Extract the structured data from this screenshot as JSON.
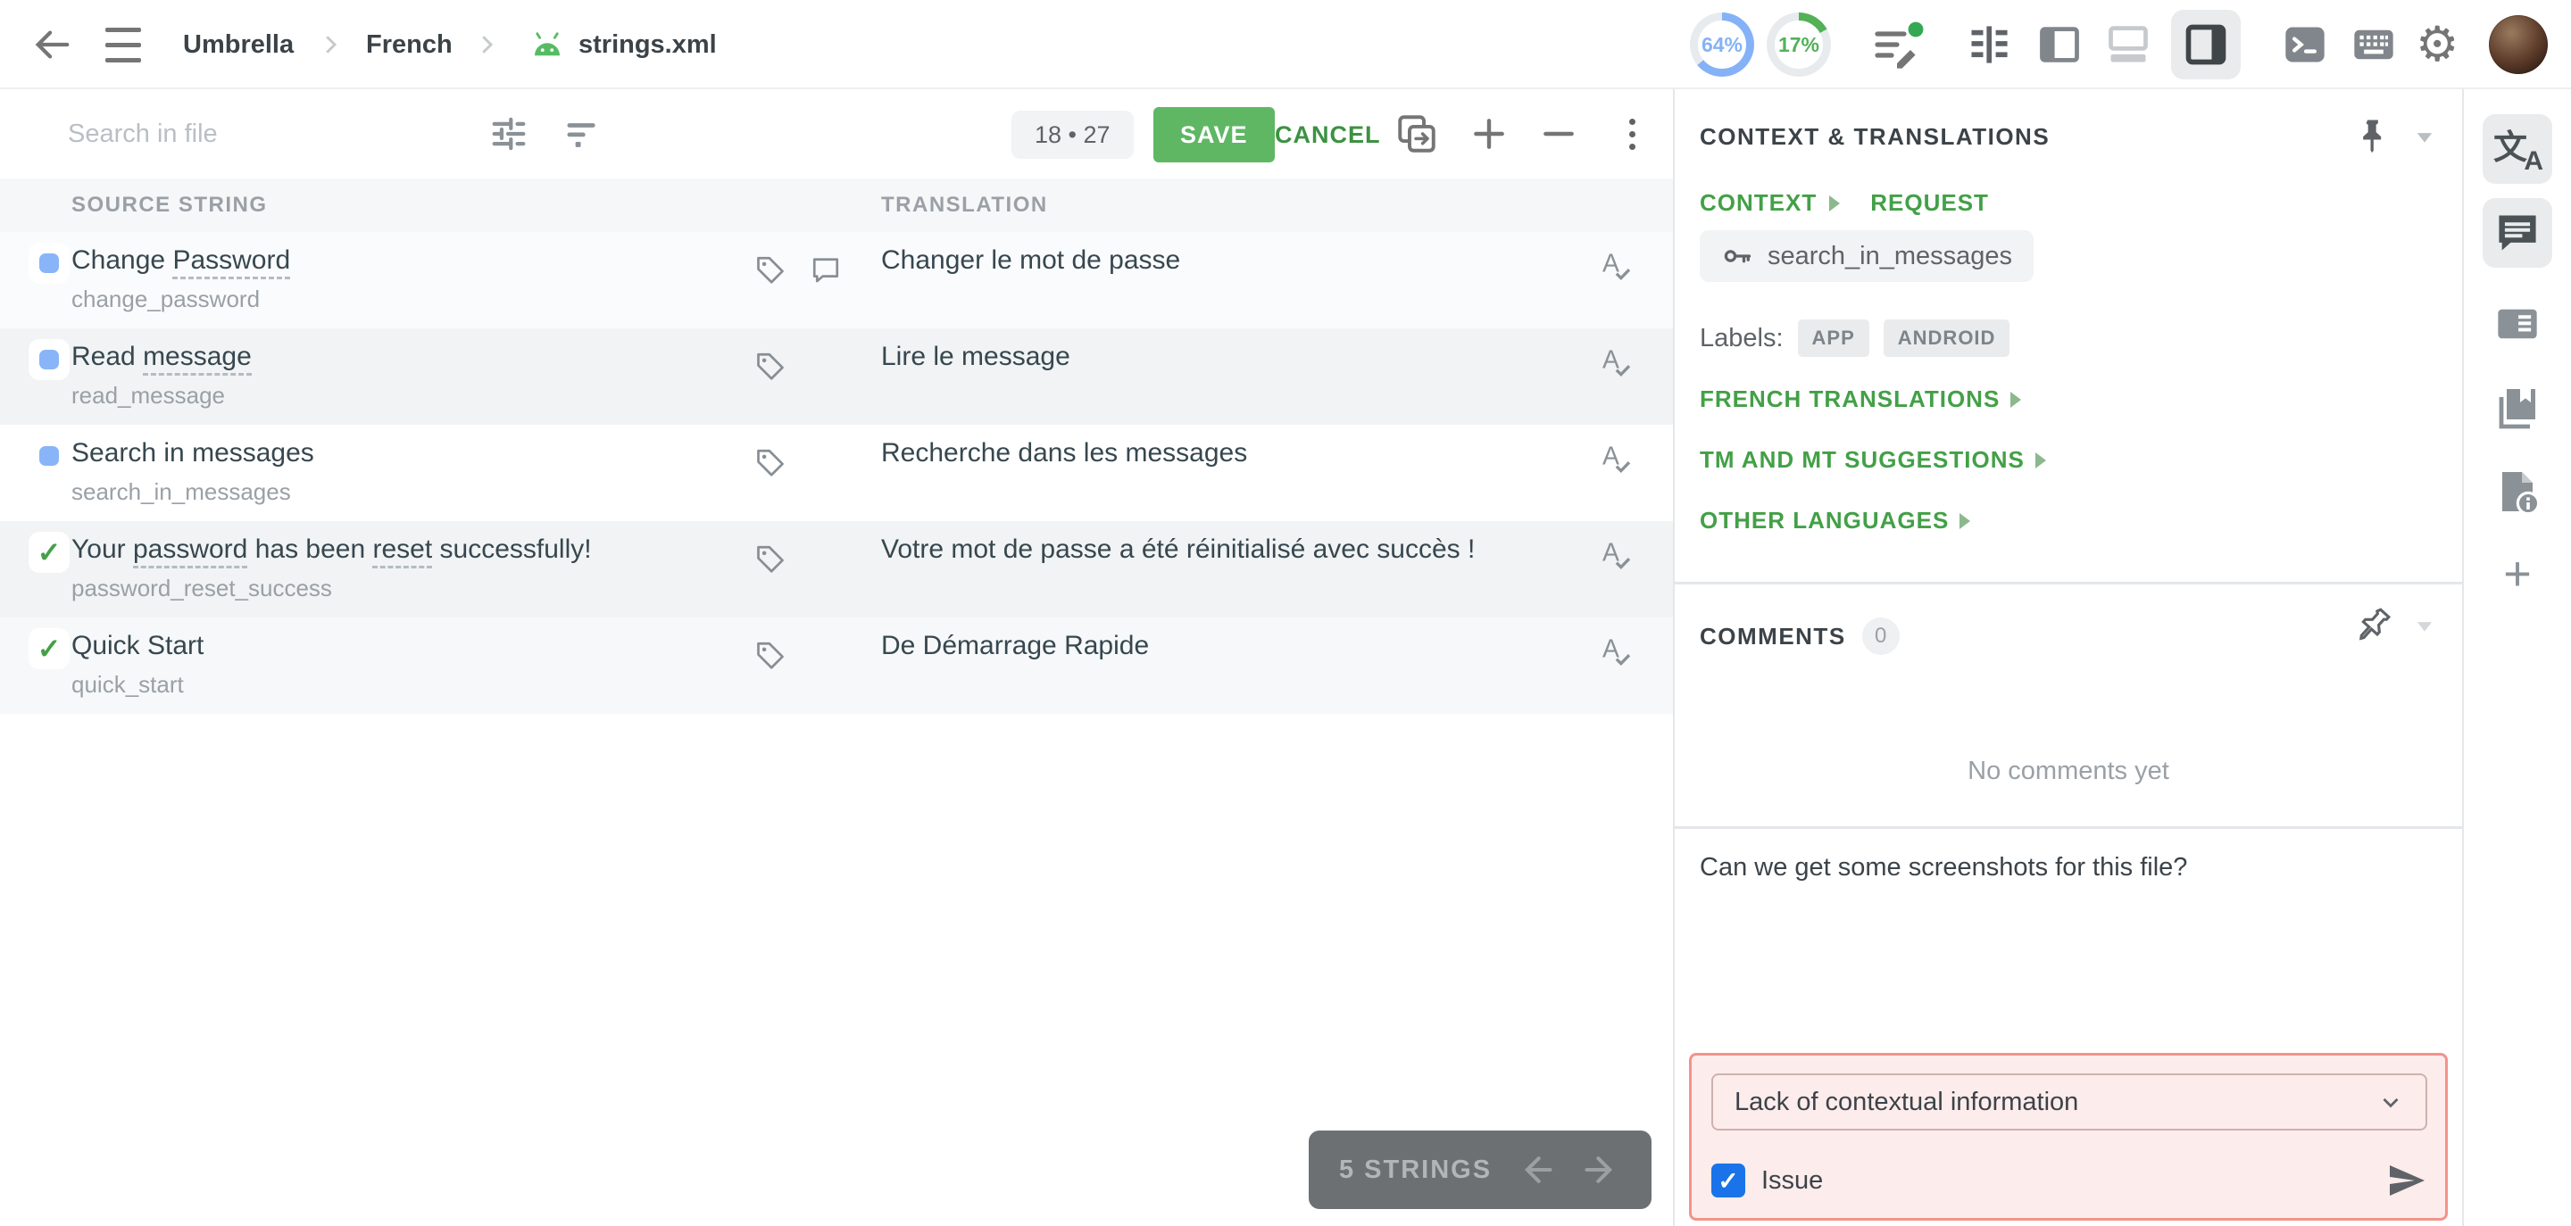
{
  "topbar": {
    "breadcrumb_project": "Umbrella",
    "breadcrumb_language": "French",
    "breadcrumb_file": "strings.xml",
    "progress_translated": "64%",
    "progress_approved": "17%"
  },
  "toolbar": {
    "search_placeholder": "Search in file",
    "counter": "18 • 27",
    "save_label": "SAVE",
    "cancel_label": "CANCEL"
  },
  "table": {
    "source_header": "SOURCE STRING",
    "translation_header": "TRANSLATION"
  },
  "strings": [
    {
      "status": "untranslated",
      "source": [
        {
          "t": "Change ",
          "u": false
        },
        {
          "t": "Password",
          "u": true
        }
      ],
      "key": "change_password",
      "icons": [
        "tag",
        "comment"
      ],
      "translation": "Changer le mot de passe"
    },
    {
      "status": "untranslated",
      "source": [
        {
          "t": "Read ",
          "u": false
        },
        {
          "t": "message",
          "u": true
        }
      ],
      "key": "read_message",
      "icons": [
        "tag"
      ],
      "translation": "Lire le message"
    },
    {
      "status": "untranslated",
      "source": [
        {
          "t": "Search in messages",
          "u": false
        }
      ],
      "key": "search_in_messages",
      "icons": [
        "tag"
      ],
      "translation": "Recherche dans les messages"
    },
    {
      "status": "approved",
      "source": [
        {
          "t": "Your ",
          "u": false
        },
        {
          "t": "password",
          "u": true
        },
        {
          "t": " has been ",
          "u": false
        },
        {
          "t": "reset",
          "u": true
        },
        {
          "t": " successfully!",
          "u": false
        }
      ],
      "key": "password_reset_success",
      "icons": [
        "tag"
      ],
      "translation": "Votre mot de passe a été réinitialisé avec succès !"
    },
    {
      "status": "approved",
      "source": [
        {
          "t": "Quick Start",
          "u": false
        }
      ],
      "key": "quick_start",
      "icons": [
        "tag"
      ],
      "translation": "De Démarrage Rapide"
    }
  ],
  "context": {
    "title": "CONTEXT & TRANSLATIONS",
    "tab_context": "CONTEXT",
    "tab_request": "REQUEST",
    "string_key": "search_in_messages",
    "labels_caption": "Labels:",
    "labels": [
      "APP",
      "ANDROID"
    ],
    "section_french": "FRENCH TRANSLATIONS",
    "section_tm": "TM AND MT SUGGESTIONS",
    "section_other": "OTHER LANGUAGES"
  },
  "comments": {
    "title": "COMMENTS",
    "count": "0",
    "empty": "No comments yet",
    "draft": "Can we get some screenshots for this file?"
  },
  "issue": {
    "type_selected": "Lack of contextual information",
    "checkbox_label": "Issue",
    "checked": true
  },
  "footer": {
    "count_label": "5 STRINGS"
  },
  "colors": {
    "accent_green": "#43a047",
    "save_green": "#5fb764",
    "progress_blue": "#85b2f6",
    "progress_green": "#53b158",
    "untranslated_blue": "#8ab4f8",
    "issue_highlight_border": "#f2938c",
    "issue_highlight_bg": "#fdecec",
    "checkbox_blue": "#1a73e8",
    "row_alt_bg": "#f1f3f4"
  }
}
